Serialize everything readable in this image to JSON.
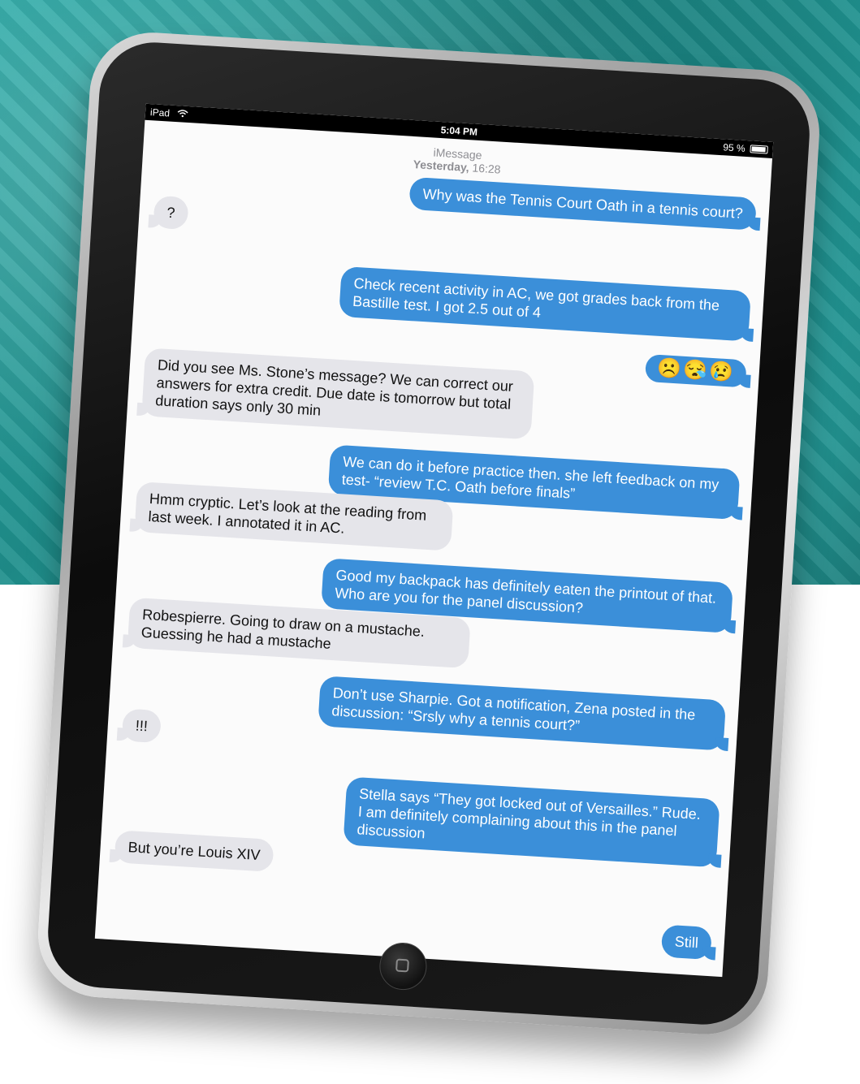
{
  "status_bar": {
    "carrier": "iPad",
    "time": "5:04 PM",
    "battery": "95 %"
  },
  "header": {
    "service": "iMessage",
    "day": "Yesterday,",
    "time": "16:28"
  },
  "messages": [
    {
      "side": "out",
      "text": "Why was the Tennis Court Oath in a tennis court?"
    },
    {
      "side": "in",
      "text": "?"
    },
    {
      "side": "out",
      "text": "Check recent activity in AC, we got grades back from the Bastille test. I got 2.5 out of 4"
    },
    {
      "side": "out",
      "text": "☹️😪😢"
    },
    {
      "side": "in",
      "text": "Did you see Ms. Stone’s message? We can correct our answers for extra credit. Due date is tomorrow but total duration says only 30 min"
    },
    {
      "side": "out",
      "text": "We can do it before practice then. she left feedback on my test- “review T.C. Oath before finals”"
    },
    {
      "side": "in",
      "text": "Hmm cryptic. Let’s look at the  reading from last week. I annotated it in AC."
    },
    {
      "side": "out",
      "text": "Good my backpack has definitely eaten the printout of that. Who are you for the panel discussion?"
    },
    {
      "side": "in",
      "text": "Robespierre. Going to draw on a mustache. Guessing he had a mustache"
    },
    {
      "side": "out",
      "text": "Don’t use Sharpie. Got a notification, Zena posted in the discussion: “Srsly why a tennis court?”"
    },
    {
      "side": "in",
      "text": "!!!"
    },
    {
      "side": "out",
      "text": "Stella says “They got locked out of Versailles.” Rude. I am definitely complaining about this in the panel discussion"
    },
    {
      "side": "in",
      "text": "But you’re Louis XIV"
    },
    {
      "side": "out",
      "text": "Still"
    }
  ],
  "colors": {
    "outgoing_bubble": "#3b8fd9",
    "incoming_bubble": "#e5e5ea",
    "background_teal": "#2aa9a6"
  }
}
